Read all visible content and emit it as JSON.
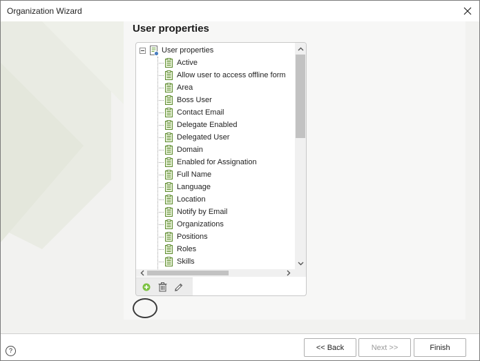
{
  "window": {
    "title": "Organization Wizard"
  },
  "page": {
    "heading": "User properties"
  },
  "tree": {
    "root_label": "User properties",
    "items": [
      "Active",
      "Allow user to access offline form",
      "Area",
      "Boss User",
      "Contact Email",
      "Delegate Enabled",
      "Delegated User",
      "Domain",
      "Enabled for Assignation",
      "Full Name",
      "Language",
      "Location",
      "Notify by Email",
      "Organizations",
      "Positions",
      "Roles",
      "Skills"
    ]
  },
  "footer": {
    "help_label": "?",
    "back_label": "<< Back",
    "next_label": "Next >>",
    "finish_label": "Finish"
  },
  "colors": {
    "content_bg": "#f2f2f0",
    "panel_bg": "#f7f7f6",
    "property_icon_green": "#7ab040",
    "add_icon_green": "#7cc242",
    "disabled_text": "#9a9a9a"
  }
}
